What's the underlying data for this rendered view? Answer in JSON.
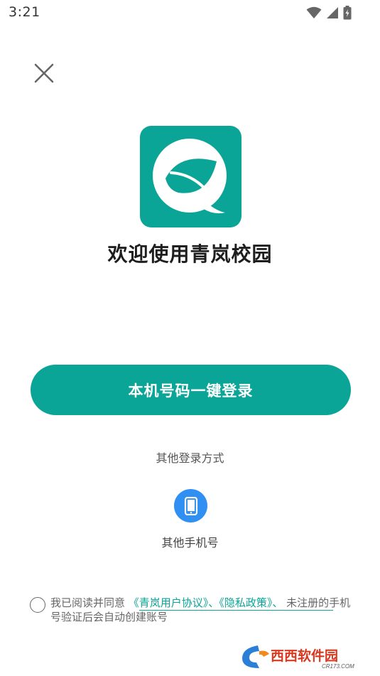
{
  "status_bar": {
    "time": "3:21",
    "icons": [
      "wifi-icon",
      "signal-icon",
      "battery-icon"
    ]
  },
  "header": {
    "close_icon": "close-icon"
  },
  "app": {
    "welcome_text": "欢迎使用青岚校园",
    "logo_icon": "leaf-q-logo-icon",
    "brand_color": "#0aa596"
  },
  "login": {
    "one_click_label": "本机号码一键登录",
    "other_methods_label": "其他登录方式",
    "other_phone_label": "其他手机号",
    "phone_icon": "phone-icon",
    "phone_icon_color": "#2f8ff2"
  },
  "agreement": {
    "prefix": "我已阅读并同意 ",
    "user_agreement_link": "《青岚用户协议》",
    "separator1": "、",
    "privacy_policy_link": "《隐私政策》",
    "separator2": "、",
    "suffix": " 未注册的手机号验证后会自动创建账号"
  },
  "watermark": {
    "brand": "西西软件园",
    "url": "CR173.COM"
  }
}
